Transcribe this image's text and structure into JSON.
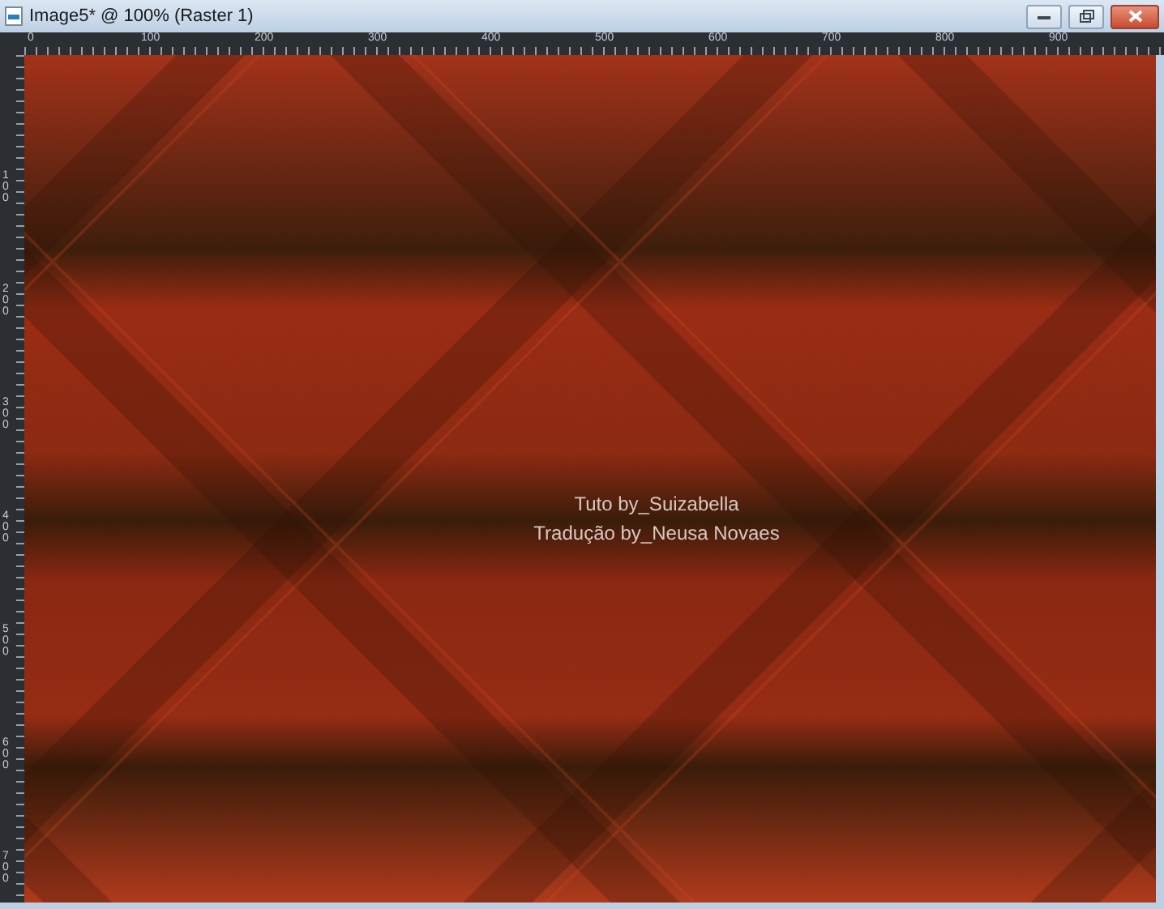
{
  "window": {
    "title": "Image5* @ 100% (Raster 1)"
  },
  "rulers": {
    "horizontal": [
      "0",
      "100",
      "200",
      "300",
      "400",
      "500",
      "600",
      "700",
      "800",
      "900"
    ],
    "vertical": [
      "100",
      "200",
      "300",
      "400",
      "500",
      "600",
      "700"
    ]
  },
  "canvas": {
    "caption": [
      "Tuto by_Suizabella",
      "Tradução by_Neusa Novaes"
    ]
  }
}
